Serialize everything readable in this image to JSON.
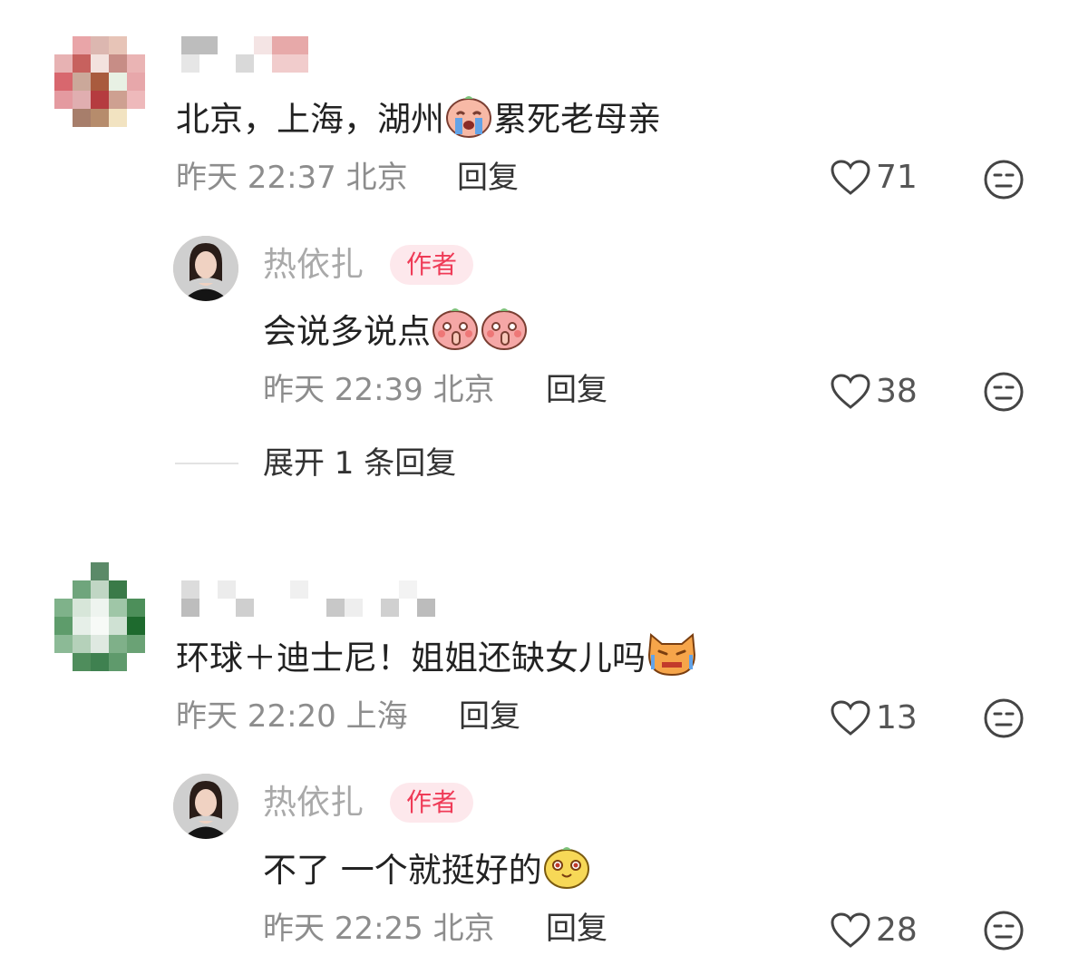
{
  "comments": [
    {
      "text": "北京，上海，湖州",
      "text_after_emoji": "累死老母亲",
      "emoji": "crying-face-emoji",
      "time": "昨天 22:37 北京",
      "reply_label": "回复",
      "likes": "71",
      "reply": {
        "author_name": "热依扎",
        "badge": "作者",
        "text": "会说多说点",
        "emoji": "shushing-face-emoji",
        "time": "昨天 22:39 北京",
        "reply_label": "回复",
        "likes": "38"
      },
      "expand_label": "展开 1 条回复"
    },
    {
      "text": "环球＋迪士尼！姐姐还缺女儿吗",
      "emoji": "crying-cat-emoji",
      "time": "昨天 22:20 上海",
      "reply_label": "回复",
      "likes": "13",
      "reply": {
        "author_name": "热依扎",
        "badge": "作者",
        "text": "不了 一个就挺好的",
        "emoji": "smiling-face-emoji",
        "time": "昨天 22:25 北京",
        "reply_label": "回复",
        "likes": "28"
      }
    }
  ],
  "colors": {
    "badge_text": "#ef3b57",
    "badge_bg": "#fde8ec",
    "meta_text": "#8d8d8d"
  }
}
